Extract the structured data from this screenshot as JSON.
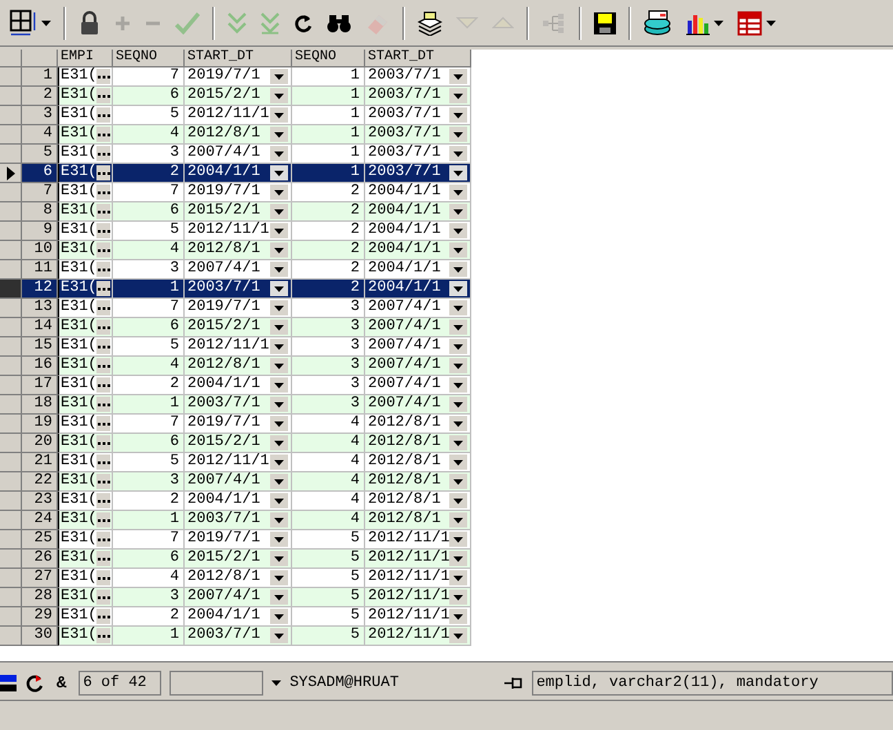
{
  "toolbar": [
    {
      "kind": "grid",
      "disabled": false,
      "dropdown": true
    },
    {
      "kind": "separator"
    },
    {
      "kind": "lock",
      "disabled": false
    },
    {
      "kind": "plus",
      "disabled": true
    },
    {
      "kind": "minus",
      "disabled": true
    },
    {
      "kind": "check",
      "disabled": true
    },
    {
      "kind": "separator"
    },
    {
      "kind": "fetch-next",
      "disabled": true
    },
    {
      "kind": "fetch-last",
      "disabled": true
    },
    {
      "kind": "refresh",
      "disabled": false
    },
    {
      "kind": "binoculars",
      "disabled": false
    },
    {
      "kind": "eraser",
      "disabled": true
    },
    {
      "kind": "separator"
    },
    {
      "kind": "papers",
      "disabled": false
    },
    {
      "kind": "triangle-down",
      "disabled": true
    },
    {
      "kind": "triangle-up",
      "disabled": true
    },
    {
      "kind": "separator"
    },
    {
      "kind": "tree",
      "disabled": true
    },
    {
      "kind": "separator"
    },
    {
      "kind": "floppy",
      "disabled": false
    },
    {
      "kind": "separator"
    },
    {
      "kind": "database",
      "disabled": false
    },
    {
      "kind": "bar-chart",
      "disabled": false,
      "dropdown": true
    },
    {
      "kind": "table",
      "disabled": false,
      "dropdown": true
    }
  ],
  "grid": {
    "columns": [
      "EMPI",
      "SEQNO",
      "START_DT",
      "SEQNO",
      "START_DT"
    ],
    "rows": [
      {
        "num": "1",
        "empl": "E31(",
        "seqno": "7",
        "start_dt": "2019/7/1",
        "seqno_2": "1",
        "start_dt_2": "2003/7/1",
        "selected": false,
        "current": false
      },
      {
        "num": "2",
        "empl": "E31(",
        "seqno": "6",
        "start_dt": "2015/2/1",
        "seqno_2": "1",
        "start_dt_2": "2003/7/1",
        "selected": false,
        "current": false
      },
      {
        "num": "3",
        "empl": "E31(",
        "seqno": "5",
        "start_dt": "2012/11/1",
        "seqno_2": "1",
        "start_dt_2": "2003/7/1",
        "selected": false,
        "current": false
      },
      {
        "num": "4",
        "empl": "E31(",
        "seqno": "4",
        "start_dt": "2012/8/1",
        "seqno_2": "1",
        "start_dt_2": "2003/7/1",
        "selected": false,
        "current": false
      },
      {
        "num": "5",
        "empl": "E31(",
        "seqno": "3",
        "start_dt": "2007/4/1",
        "seqno_2": "1",
        "start_dt_2": "2003/7/1",
        "selected": false,
        "current": false
      },
      {
        "num": "6",
        "empl": "E31(",
        "seqno": "2",
        "start_dt": "2004/1/1",
        "seqno_2": "1",
        "start_dt_2": "2003/7/1",
        "selected": true,
        "current": true
      },
      {
        "num": "7",
        "empl": "E31(",
        "seqno": "7",
        "start_dt": "2019/7/1",
        "seqno_2": "2",
        "start_dt_2": "2004/1/1",
        "selected": false,
        "current": false
      },
      {
        "num": "8",
        "empl": "E31(",
        "seqno": "6",
        "start_dt": "2015/2/1",
        "seqno_2": "2",
        "start_dt_2": "2004/1/1",
        "selected": false,
        "current": false
      },
      {
        "num": "9",
        "empl": "E31(",
        "seqno": "5",
        "start_dt": "2012/11/1",
        "seqno_2": "2",
        "start_dt_2": "2004/1/1",
        "selected": false,
        "current": false
      },
      {
        "num": "10",
        "empl": "E31(",
        "seqno": "4",
        "start_dt": "2012/8/1",
        "seqno_2": "2",
        "start_dt_2": "2004/1/1",
        "selected": false,
        "current": false
      },
      {
        "num": "11",
        "empl": "E31(",
        "seqno": "3",
        "start_dt": "2007/4/1",
        "seqno_2": "2",
        "start_dt_2": "2004/1/1",
        "selected": false,
        "current": false
      },
      {
        "num": "12",
        "empl": "E31(",
        "seqno": "1",
        "start_dt": "2003/7/1",
        "seqno_2": "2",
        "start_dt_2": "2004/1/1",
        "selected": true,
        "current": false
      },
      {
        "num": "13",
        "empl": "E31(",
        "seqno": "7",
        "start_dt": "2019/7/1",
        "seqno_2": "3",
        "start_dt_2": "2007/4/1",
        "selected": false,
        "current": false
      },
      {
        "num": "14",
        "empl": "E31(",
        "seqno": "6",
        "start_dt": "2015/2/1",
        "seqno_2": "3",
        "start_dt_2": "2007/4/1",
        "selected": false,
        "current": false
      },
      {
        "num": "15",
        "empl": "E31(",
        "seqno": "5",
        "start_dt": "2012/11/1",
        "seqno_2": "3",
        "start_dt_2": "2007/4/1",
        "selected": false,
        "current": false
      },
      {
        "num": "16",
        "empl": "E31(",
        "seqno": "4",
        "start_dt": "2012/8/1",
        "seqno_2": "3",
        "start_dt_2": "2007/4/1",
        "selected": false,
        "current": false
      },
      {
        "num": "17",
        "empl": "E31(",
        "seqno": "2",
        "start_dt": "2004/1/1",
        "seqno_2": "3",
        "start_dt_2": "2007/4/1",
        "selected": false,
        "current": false
      },
      {
        "num": "18",
        "empl": "E31(",
        "seqno": "1",
        "start_dt": "2003/7/1",
        "seqno_2": "3",
        "start_dt_2": "2007/4/1",
        "selected": false,
        "current": false
      },
      {
        "num": "19",
        "empl": "E31(",
        "seqno": "7",
        "start_dt": "2019/7/1",
        "seqno_2": "4",
        "start_dt_2": "2012/8/1",
        "selected": false,
        "current": false
      },
      {
        "num": "20",
        "empl": "E31(",
        "seqno": "6",
        "start_dt": "2015/2/1",
        "seqno_2": "4",
        "start_dt_2": "2012/8/1",
        "selected": false,
        "current": false
      },
      {
        "num": "21",
        "empl": "E31(",
        "seqno": "5",
        "start_dt": "2012/11/1",
        "seqno_2": "4",
        "start_dt_2": "2012/8/1",
        "selected": false,
        "current": false
      },
      {
        "num": "22",
        "empl": "E31(",
        "seqno": "3",
        "start_dt": "2007/4/1",
        "seqno_2": "4",
        "start_dt_2": "2012/8/1",
        "selected": false,
        "current": false
      },
      {
        "num": "23",
        "empl": "E31(",
        "seqno": "2",
        "start_dt": "2004/1/1",
        "seqno_2": "4",
        "start_dt_2": "2012/8/1",
        "selected": false,
        "current": false
      },
      {
        "num": "24",
        "empl": "E31(",
        "seqno": "1",
        "start_dt": "2003/7/1",
        "seqno_2": "4",
        "start_dt_2": "2012/8/1",
        "selected": false,
        "current": false
      },
      {
        "num": "25",
        "empl": "E31(",
        "seqno": "7",
        "start_dt": "2019/7/1",
        "seqno_2": "5",
        "start_dt_2": "2012/11/1",
        "selected": false,
        "current": false
      },
      {
        "num": "26",
        "empl": "E31(",
        "seqno": "6",
        "start_dt": "2015/2/1",
        "seqno_2": "5",
        "start_dt_2": "2012/11/1",
        "selected": false,
        "current": false
      },
      {
        "num": "27",
        "empl": "E31(",
        "seqno": "4",
        "start_dt": "2012/8/1",
        "seqno_2": "5",
        "start_dt_2": "2012/11/1",
        "selected": false,
        "current": false
      },
      {
        "num": "28",
        "empl": "E31(",
        "seqno": "3",
        "start_dt": "2007/4/1",
        "seqno_2": "5",
        "start_dt_2": "2012/11/1",
        "selected": false,
        "current": false
      },
      {
        "num": "29",
        "empl": "E31(",
        "seqno": "2",
        "start_dt": "2004/1/1",
        "seqno_2": "5",
        "start_dt_2": "2012/11/1",
        "selected": false,
        "current": false
      },
      {
        "num": "30",
        "empl": "E31(",
        "seqno": "1",
        "start_dt": "2003/7/1",
        "seqno_2": "5",
        "start_dt_2": "2012/11/1",
        "selected": false,
        "current": false
      }
    ]
  },
  "status_bar": {
    "ampersand": "&",
    "record": "6 of 42",
    "connection": "SYSADM@HRUAT",
    "column_info": "emplid, varchar2(11), mandatory"
  }
}
